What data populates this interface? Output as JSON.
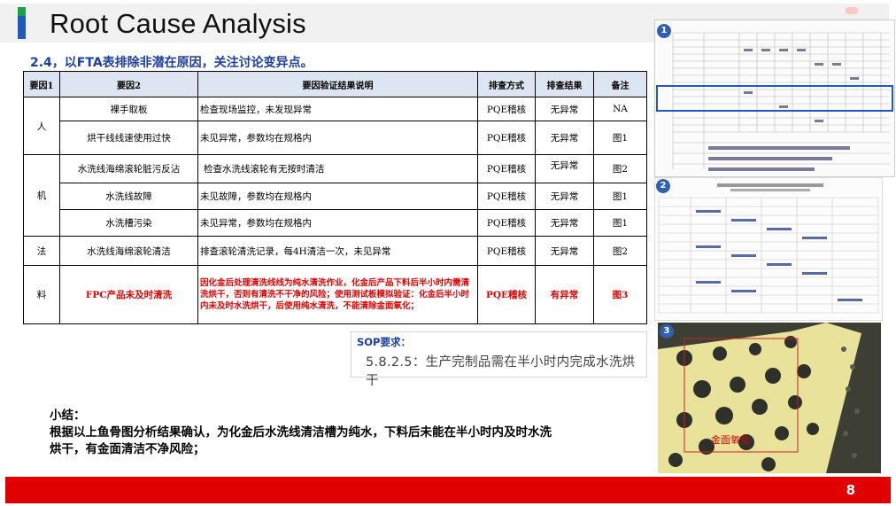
{
  "header": {
    "title": "Root Cause Analysis"
  },
  "subtitle": "2.4，以FTA表排除非潜在原因，关注讨论变异点。",
  "table": {
    "headers": [
      "要因1",
      "要因2",
      "要因验证结果说明",
      "排查方式",
      "排查结果",
      "备注"
    ],
    "groups": [
      {
        "category": "人",
        "rows": [
          {
            "factor": "裸手取板",
            "detail": "检查现场监控，未发现异常",
            "method": "PQE稽核",
            "result": "无异常",
            "note": "NA"
          },
          {
            "factor": "烘干线线速使用过快",
            "detail": "未见异常，参数均在规格内",
            "method": "PQE稽核",
            "result": "无异常",
            "note": "图1"
          }
        ]
      },
      {
        "category": "机",
        "rows": [
          {
            "factor": "水洗线海绵滚轮脏污反沾",
            "detail": "检查水洗线滚轮有无按时清洁",
            "method": "PQE稽核",
            "result": "无异常",
            "note": "图2"
          },
          {
            "factor": "水洗线故障",
            "detail": "未见故障，参数均在规格内",
            "method": "PQE稽核",
            "result": "无异常",
            "note": "图1"
          },
          {
            "factor": "水洗槽污染",
            "detail": "未见异常，参数均在规格内",
            "method": "PQE稽核",
            "result": "无异常",
            "note": "图1"
          }
        ]
      },
      {
        "category": "法",
        "rows": [
          {
            "factor": "水洗线海绵滚轮清洁",
            "detail": "排查滚轮清洗记录，每4H清洁一次，未见异常",
            "method": "PQE稽核",
            "result": "无异常",
            "note": "图2"
          }
        ]
      },
      {
        "category": "料",
        "rows": [
          {
            "factor": "FPC产品未及时清洗",
            "detail": "因化金后处理清洗线线为纯水清洗作业，化金后产品下料后半小时内需清洗烘干，否则有清洗不干净的风险；使用测试板模拟验证：化金后半小时内未及时水洗烘干，后使用纯水清洗，不能清除金面氧化；",
            "method": "PQE稽核",
            "result": "有异常",
            "note": "图3"
          }
        ]
      }
    ]
  },
  "sop": {
    "label": "SOP要求：",
    "text": "5.8.2.5：生产完制品需在半小时内完成水洗烘干"
  },
  "summary": {
    "heading": "小结：",
    "text": "根据以上鱼骨图分析结果确认，为化金后水洗线清洁槽为纯水，下料后未能在半小时内及时水洗烘干，有金面清洁不净风险；"
  },
  "figures": {
    "badge1": "1",
    "badge2": "2",
    "badge3": "3",
    "photo_label": "金面氧化"
  },
  "footer": {
    "page_number": "8"
  },
  "colors": {
    "accent_blue": "#1e5cb3",
    "accent_green": "#16a34a",
    "footer_red": "#e10000",
    "alert_red": "#e00000"
  }
}
